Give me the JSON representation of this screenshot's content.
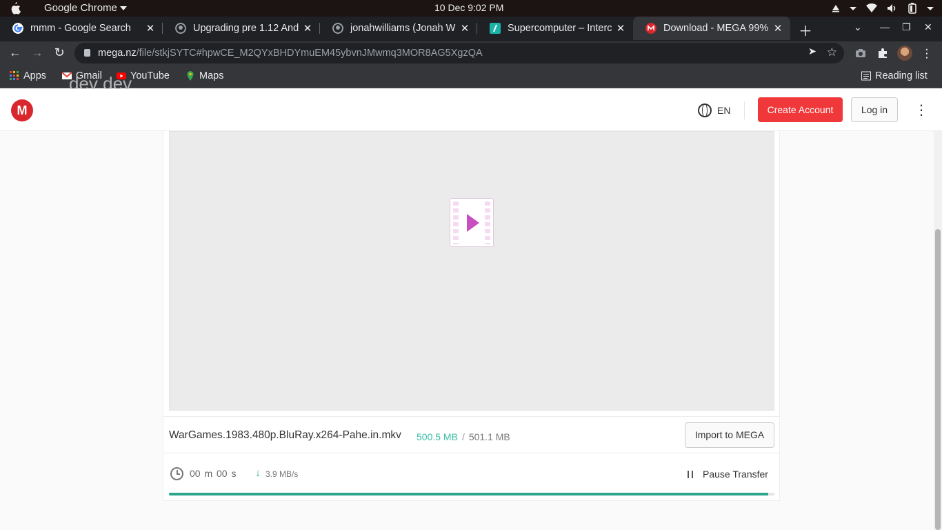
{
  "os": {
    "app_name": "Google Chrome",
    "clock": "10 Dec   9:02 PM"
  },
  "tabs": [
    {
      "title": "mmm - Google Search",
      "favicon": "google-icon"
    },
    {
      "title": "Upgrading pre 1.12 And",
      "favicon": "github-icon"
    },
    {
      "title": "jonahwilliams (Jonah W",
      "favicon": "github-icon"
    },
    {
      "title": "Supercomputer – Interc",
      "favicon": "supercomputer-icon"
    },
    {
      "title": "Download - MEGA 99%",
      "favicon": "mega-icon",
      "active": true
    }
  ],
  "address_bar": {
    "domain": "mega.nz",
    "path": "/file/stkjSYTC#hpwCE_M2QYxBHDYmuEM45ybvnJMwmq3MOR8AG5XgzQA"
  },
  "bookmarks": [
    {
      "label": "Apps",
      "icon": "apps-grid-icon"
    },
    {
      "label": "Gmail",
      "icon": "gmail-icon"
    },
    {
      "label": "YouTube",
      "icon": "youtube-icon"
    },
    {
      "label": "Maps",
      "icon": "maps-icon"
    }
  ],
  "reading_list": "Reading list",
  "overlay_text": "dev dev",
  "mega": {
    "logo_letter": "M",
    "language": "EN",
    "create_account": "Create Account",
    "login": "Log in"
  },
  "file": {
    "name": "WarGames.1983.480p.BluRay.x264-Pahe.in.mkv",
    "downloaded": "500.5 MB",
    "total": "501.1 MB",
    "import_label": "Import to MEGA"
  },
  "transfer": {
    "eta": "00 m  00 s",
    "speed": "3.9  MB/s",
    "pause_label": "Pause Transfer",
    "progress_fraction": 0.99
  },
  "colors": {
    "mega_red": "#d9272e",
    "create_button": "#f0373a",
    "progress": "#2ba68c",
    "downloaded_text": "#38bea7"
  }
}
